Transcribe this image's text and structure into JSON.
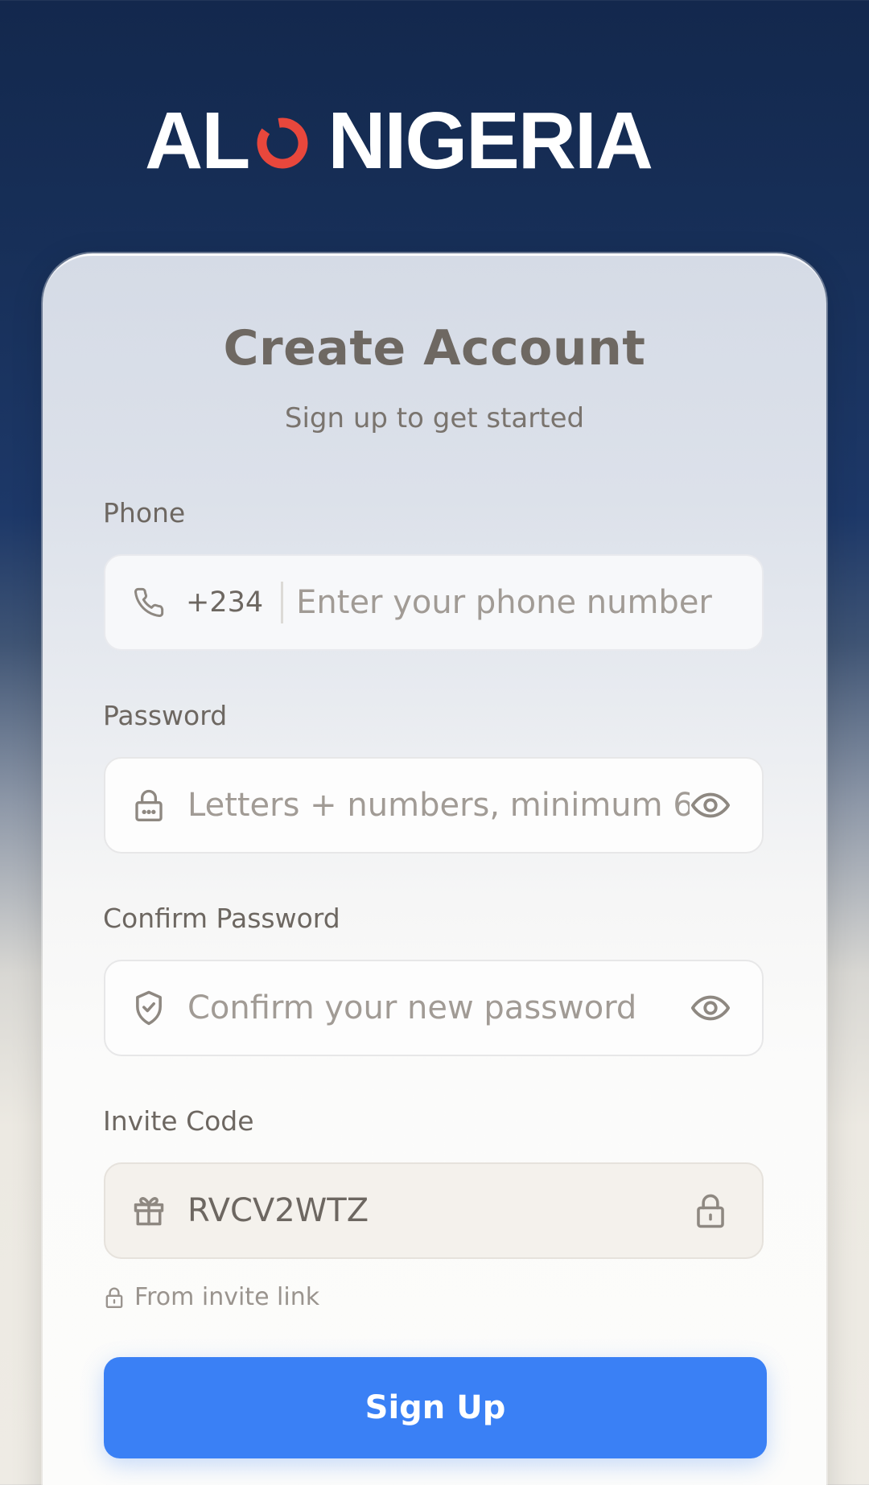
{
  "brand": {
    "prefix": "AL",
    "suffix": "NIGERIA",
    "accent_color": "#e8473c"
  },
  "form": {
    "title": "Create Account",
    "subtitle": "Sign up to get started",
    "phone": {
      "label": "Phone",
      "icon": "phone-icon",
      "country_code": "+234",
      "placeholder": "Enter your phone number",
      "value": ""
    },
    "password": {
      "label": "Password",
      "icon": "lock-icon",
      "placeholder": "Letters + numbers, minimum 6",
      "value": "",
      "toggle_icon": "eye-icon"
    },
    "confirm_password": {
      "label": "Confirm Password",
      "icon": "shield-check-icon",
      "placeholder": "Confirm your new password",
      "value": "",
      "toggle_icon": "eye-icon"
    },
    "invite_code": {
      "label": "Invite Code",
      "icon": "gift-icon",
      "value": "RVCV2WTZ",
      "lock_icon": "lock-icon",
      "hint": "From invite link"
    },
    "submit_label": "Sign Up",
    "submit_color": "#3a80f5"
  }
}
